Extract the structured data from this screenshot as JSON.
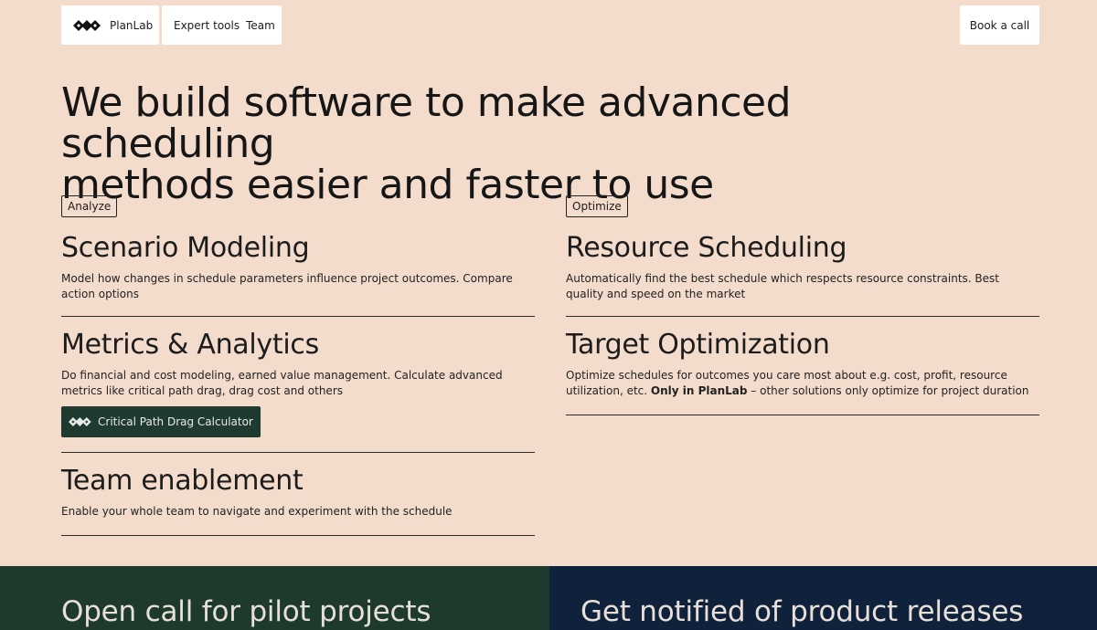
{
  "nav": {
    "brand": "PlanLab",
    "links": [
      "Expert tools",
      "Team"
    ],
    "cta": "Book a call"
  },
  "hero": {
    "title_line1": "We build software to make advanced scheduling",
    "title_line2": "methods easier and faster to use"
  },
  "left": {
    "tag": "Analyze",
    "items": [
      {
        "title": "Scenario Modeling",
        "desc": "Model how changes in schedule parameters influence project outcomes. Compare action options"
      },
      {
        "title": "Metrics & Analytics",
        "desc": "Do financial and cost modeling, earned value management. Calculate advanced metrics like critical path drag, drag cost and others",
        "button": "Critical Path Drag Calculator"
      },
      {
        "title": "Team enablement",
        "desc": "Enable your whole team to navigate and experiment with the schedule"
      }
    ]
  },
  "right": {
    "tag": "Optimize",
    "items": [
      {
        "title": "Resource Scheduling",
        "desc": "Automatically find the best schedule which respects resource constraints. Best quality and speed on the market"
      },
      {
        "title": "Target Optimization",
        "desc_pre": "Optimize schedules for outcomes you care most about e.g. cost, profit, resource utilization, etc. ",
        "desc_bold": "Only in PlanLab",
        "desc_post": " – other solutions only optimize for project duration"
      }
    ]
  },
  "footer": {
    "left_title": "Open call for pilot projects",
    "right_title": "Get notified of product releases"
  },
  "colors": {
    "background": "#f3dccb",
    "green": "#1d3a2d",
    "navy": "#10213b"
  },
  "icons": {
    "logo": "planlab-diamonds-logo"
  }
}
